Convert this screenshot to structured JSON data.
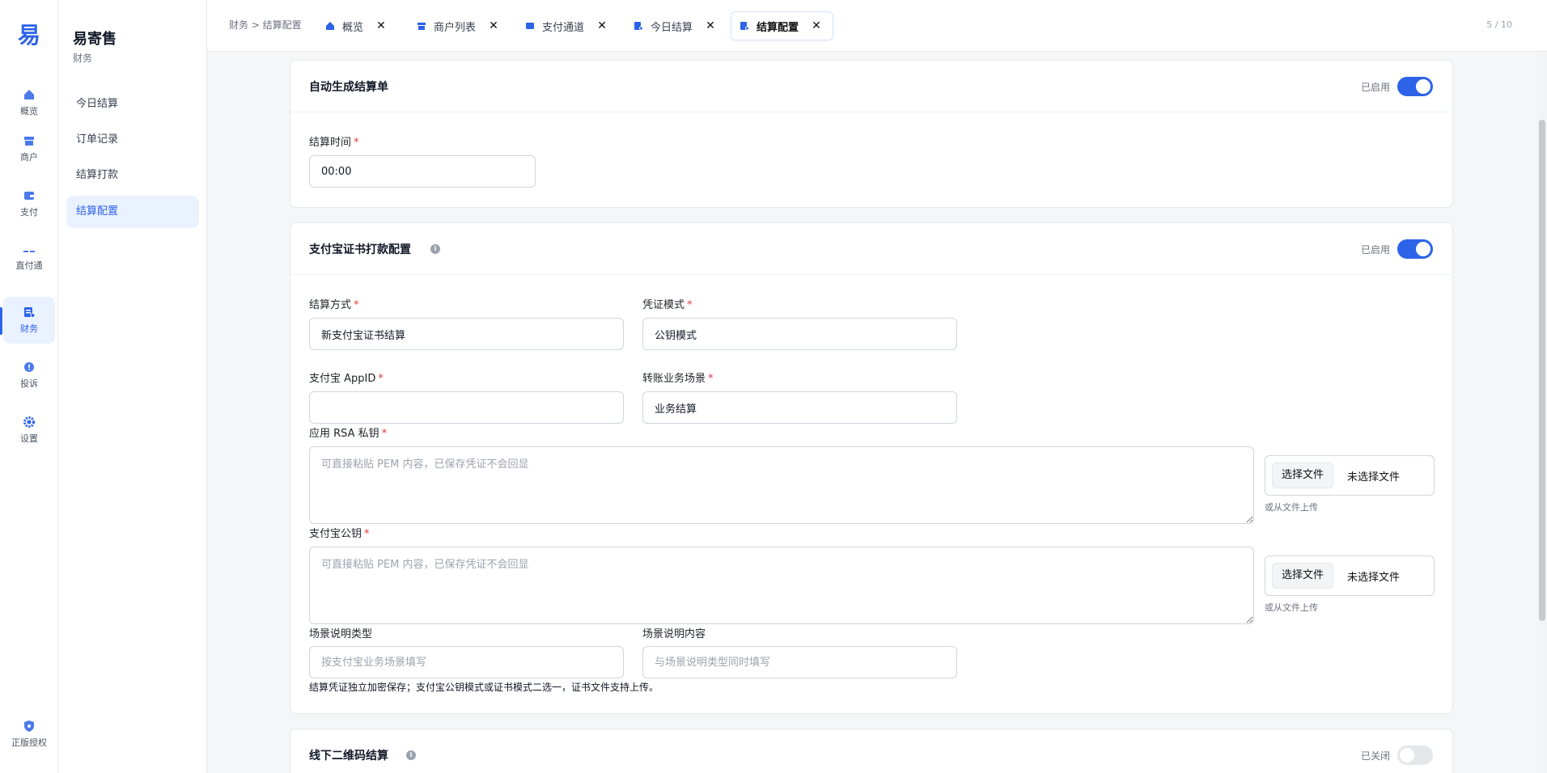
{
  "rail": {
    "logo": "易",
    "items": [
      {
        "label": "概览"
      },
      {
        "label": "商户"
      },
      {
        "label": "支付"
      },
      {
        "label": "直付通"
      },
      {
        "label": "财务"
      },
      {
        "label": "投诉"
      },
      {
        "label": "设置"
      }
    ],
    "bottom_label": "正版授权"
  },
  "subnav": {
    "title": "易寄售",
    "subtitle": "财务",
    "items": [
      {
        "label": "今日结算"
      },
      {
        "label": "订单记录"
      },
      {
        "label": "结算打款"
      },
      {
        "label": "结算配置"
      }
    ]
  },
  "topbar": {
    "breadcrumb": "财务 > 结算配置",
    "tabs": [
      {
        "label": "概览"
      },
      {
        "label": "商户列表"
      },
      {
        "label": "支付通道"
      },
      {
        "label": "今日结算"
      },
      {
        "label": "结算配置"
      }
    ],
    "close_glyph": "✕",
    "page_count": "5 / 10"
  },
  "auto_card": {
    "title": "自动生成结算单",
    "status": "已启用",
    "enabled": true,
    "time_label": "结算时间",
    "time_value": "00:00"
  },
  "alipay_card": {
    "title": "支付宝证书打款配置",
    "status": "已启用",
    "enabled": true,
    "method_label": "结算方式",
    "method_value": "新支付宝证书结算",
    "voucher_label": "凭证模式",
    "voucher_value": "公钥模式",
    "appid_label": "支付宝 AppID",
    "appid_value": "",
    "scene_label": "转账业务场景",
    "scene_value": "业务结算",
    "rsa_label": "应用 RSA 私钥",
    "rsa_placeholder": "可直接粘贴 PEM 内容，已保存凭证不会回显",
    "pubkey_label": "支付宝公钥",
    "pubkey_placeholder": "可直接粘贴 PEM 内容，已保存凭证不会回显",
    "file_button": "选择文件",
    "file_status": "未选择文件",
    "file_hint": "或从文件上传",
    "scene_type_label": "场景说明类型",
    "scene_type_placeholder": "按支付宝业务场景填写",
    "scene_content_label": "场景说明内容",
    "scene_content_placeholder": "与场景说明类型同时填写",
    "note": "结算凭证独立加密保存；支付宝公钥模式或证书模式二选一，证书文件支持上传。"
  },
  "offline_card": {
    "title": "线下二维码结算",
    "status": "已关闭",
    "enabled": false
  },
  "colors": {
    "accent": "#2d63e8",
    "required": "#e03a3a"
  }
}
